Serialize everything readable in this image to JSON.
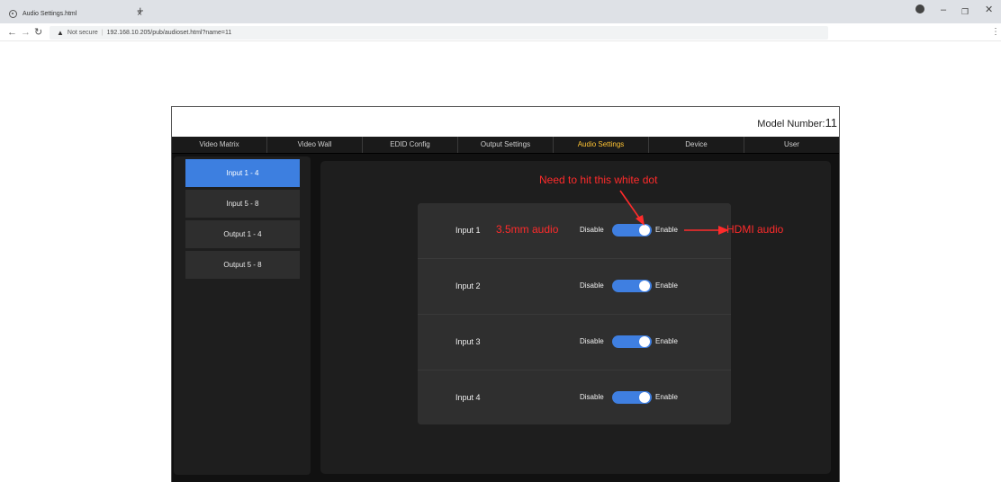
{
  "browser": {
    "tab_title": "Audio Settings.html",
    "tab_close": "×",
    "new_tab": "+",
    "not_secure": "Not secure",
    "url": "192.168.10.205/pub/audioset.html?name=11",
    "icons": [
      "globe-icon",
      "close-icon",
      "plus-icon",
      "back-icon",
      "forward-icon",
      "reload-icon",
      "warning-icon",
      "record-icon",
      "minimize-icon",
      "maximize-icon",
      "close-window-icon",
      "menu-icon"
    ]
  },
  "header": {
    "model_label": "Model Number:",
    "model_value": "11"
  },
  "nav": {
    "items": [
      "Video Matrix",
      "Video Wall",
      "EDID Config",
      "Output Settings",
      "Audio Settings",
      "Device",
      "User"
    ],
    "active": "Audio Settings",
    "active_color": "#ffc433"
  },
  "sidebar": {
    "items": [
      "Input 1 - 4",
      "Input 5 - 8",
      "Output 1 - 4",
      "Output 5 - 8"
    ],
    "active": "Input 1 - 4",
    "active_color": "#3d7fe0"
  },
  "audio_rows": [
    {
      "label": "Input 1",
      "disable": "Disable",
      "enable": "Enable",
      "enabled": true
    },
    {
      "label": "Input 2",
      "disable": "Disable",
      "enable": "Enable",
      "enabled": true
    },
    {
      "label": "Input 3",
      "disable": "Disable",
      "enable": "Enable",
      "enabled": true
    },
    {
      "label": "Input 4",
      "disable": "Disable",
      "enable": "Enable",
      "enabled": true
    }
  ],
  "annotations": {
    "top": "Need to hit this white dot",
    "left": "3.5mm audio",
    "right": "HDMI audio",
    "color": "#ff2b2b"
  }
}
